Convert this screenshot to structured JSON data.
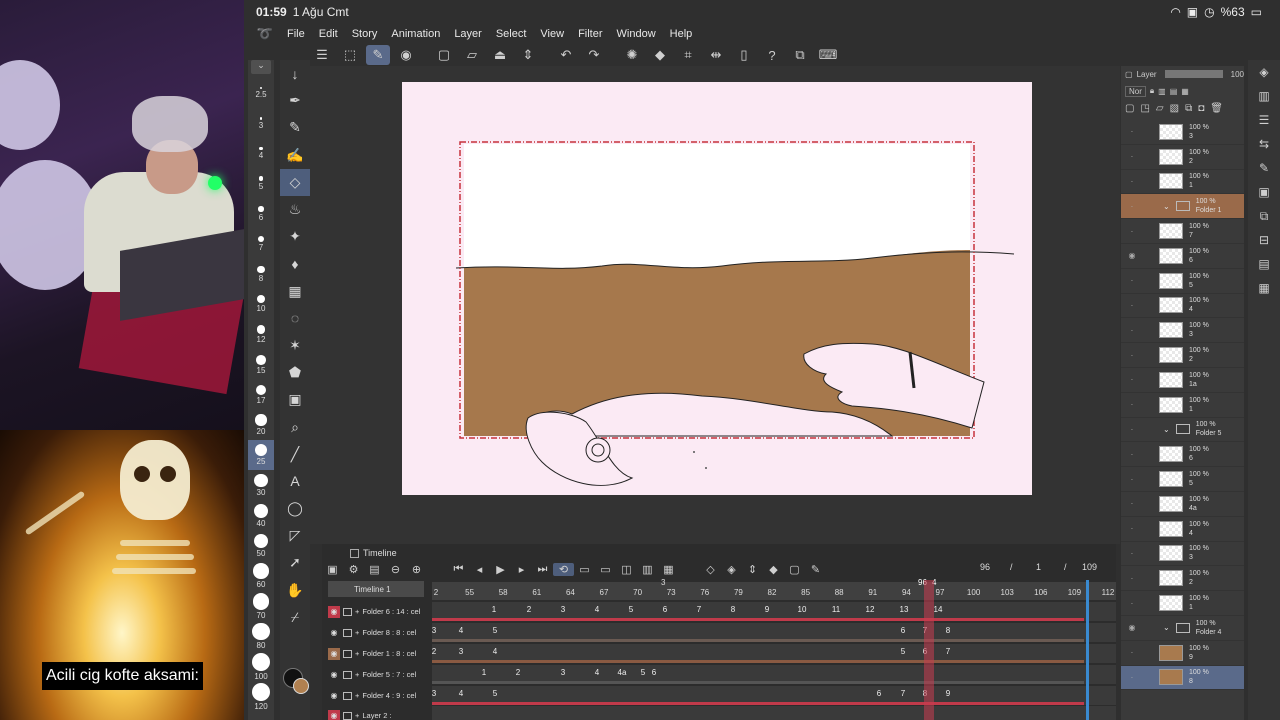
{
  "status": {
    "time": "01:59",
    "date": "1 Ağu Cmt",
    "battery": "%63"
  },
  "overlay": {
    "caption": "Acili cig kofte aksami:"
  },
  "menu": [
    "File",
    "Edit",
    "Story",
    "Animation",
    "Layer",
    "Select",
    "View",
    "Filter",
    "Window",
    "Help"
  ],
  "brush_sizes": [
    "2.5",
    "3",
    "4",
    "5",
    "6",
    "7",
    "8",
    "10",
    "12",
    "15",
    "17",
    "20",
    "25",
    "30",
    "40",
    "50",
    "60",
    "70",
    "80",
    "100",
    "120"
  ],
  "selected_brush_size": "25",
  "tools": [
    "move-icon",
    "pen-icon",
    "pencil-icon",
    "brush-icon",
    "eraser-icon",
    "blend-icon",
    "sparkle-icon",
    "fill-icon",
    "grid-icon",
    "lasso-icon",
    "wand-icon",
    "bucket-icon",
    "gradient-icon",
    "zoom-icon",
    "line-icon",
    "text-icon",
    "balloon-icon",
    "frame-icon",
    "pointer-icon",
    "hand-icon",
    "eyedropper-icon"
  ],
  "colors": {
    "main": "#111111",
    "sub": "#b08050",
    "fill": "#a87a4e",
    "paper": "#fbeaf4",
    "playhead": "#c03a4a"
  },
  "timeline": {
    "tab": "Timeline",
    "name": "Timeline 1",
    "current": "96",
    "step": "1",
    "total": "109",
    "ruler": [
      "2",
      "55",
      "58",
      "61",
      "64",
      "67",
      "70",
      "73",
      "76",
      "79",
      "82",
      "85",
      "88",
      "91",
      "94",
      "97",
      "100",
      "103",
      "106",
      "109",
      "112"
    ],
    "marker_top": "3",
    "playhead_label": "96",
    "playhead_sub": "4",
    "tracks": [
      {
        "name": "Folder 6 : 14 : cel",
        "cels": [
          "1",
          "2",
          "3",
          "4",
          "5",
          "6",
          "7",
          "8",
          "9",
          "10",
          "11",
          "12",
          "13",
          "14"
        ]
      },
      {
        "name": "Folder 8 : 8 : cel",
        "cels": [
          "3",
          "4",
          "5",
          "6",
          "7",
          "8"
        ]
      },
      {
        "name": "Folder 1 : 8 : cel",
        "cels": [
          "2",
          "3",
          "4",
          "5",
          "6",
          "7"
        ]
      },
      {
        "name": "Folder 5 : 7 : cel",
        "cels": [
          "1",
          "2",
          "3",
          "4",
          "4a",
          "5",
          "6"
        ]
      },
      {
        "name": "Folder 4 : 9 : cel",
        "cels": [
          "3",
          "4",
          "5",
          "6",
          "7",
          "8",
          "9"
        ]
      },
      {
        "name": "Layer 2 :",
        "cels": []
      }
    ]
  },
  "layers_panel": {
    "tab": "Layer",
    "blend": "Nor",
    "opacity": "100",
    "items": [
      {
        "op": "100 %",
        "name": "3",
        "type": "layer"
      },
      {
        "op": "100 %",
        "name": "2",
        "type": "layer"
      },
      {
        "op": "100 %",
        "name": "1",
        "type": "layer"
      },
      {
        "op": "100 %",
        "name": "Folder 1",
        "type": "folder"
      },
      {
        "op": "100 %",
        "name": "7",
        "type": "layer"
      },
      {
        "op": "100 %",
        "name": "6",
        "type": "layer"
      },
      {
        "op": "100 %",
        "name": "5",
        "type": "layer"
      },
      {
        "op": "100 %",
        "name": "4",
        "type": "layer"
      },
      {
        "op": "100 %",
        "name": "3",
        "type": "layer"
      },
      {
        "op": "100 %",
        "name": "2",
        "type": "layer"
      },
      {
        "op": "100 %",
        "name": "1a",
        "type": "layer"
      },
      {
        "op": "100 %",
        "name": "1",
        "type": "layer"
      },
      {
        "op": "100 %",
        "name": "Folder 5",
        "type": "folder"
      },
      {
        "op": "100 %",
        "name": "6",
        "type": "layer"
      },
      {
        "op": "100 %",
        "name": "5",
        "type": "layer"
      },
      {
        "op": "100 %",
        "name": "4a",
        "type": "layer"
      },
      {
        "op": "100 %",
        "name": "4",
        "type": "layer"
      },
      {
        "op": "100 %",
        "name": "3",
        "type": "layer"
      },
      {
        "op": "100 %",
        "name": "2",
        "type": "layer"
      },
      {
        "op": "100 %",
        "name": "1",
        "type": "layer"
      },
      {
        "op": "100 %",
        "name": "Folder 4",
        "type": "folder"
      },
      {
        "op": "100 %",
        "name": "9",
        "type": "layer"
      },
      {
        "op": "100 %",
        "name": "8",
        "type": "layer"
      }
    ]
  }
}
